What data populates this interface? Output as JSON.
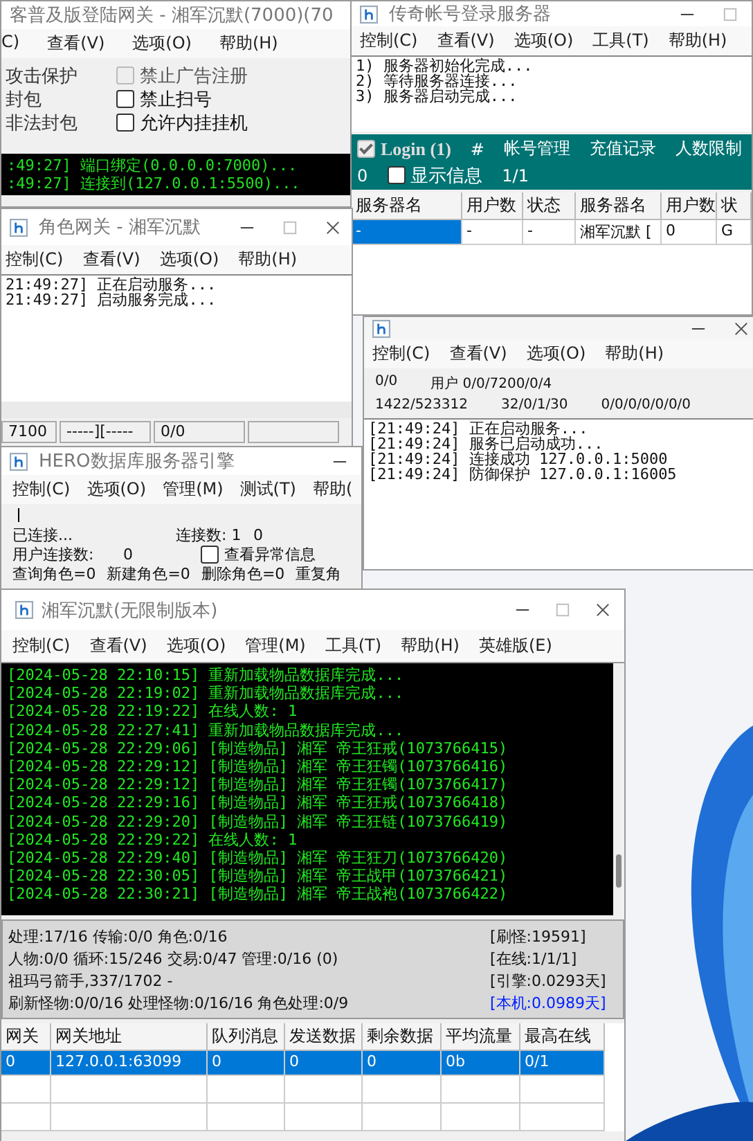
{
  "login_gateway": {
    "title": "客普及版登陆网关 - 湘军沉默(7000)(70",
    "menu": [
      "C)",
      "查看(V)",
      "选项(O)",
      "帮助(H)"
    ],
    "options_left": [
      "攻击保护",
      "封包",
      "非法封包"
    ],
    "options_right": [
      {
        "label": "禁止广告注册",
        "checked": false,
        "disabled": true
      },
      {
        "label": "禁止扫号",
        "checked": false,
        "disabled": false
      },
      {
        "label": "允许内挂挂机",
        "checked": false,
        "disabled": false
      }
    ],
    "log": [
      ":49:27] 端口绑定(0.0.0.0:7000)...",
      ":49:27] 连接到(127.0.0.1:5500)..."
    ]
  },
  "account_server": {
    "title": "传奇帐号登录服务器",
    "menu": [
      "控制(C)",
      "查看(V)",
      "选项(O)",
      "工具(T)",
      "帮助(H)"
    ],
    "log": [
      "1) 服务器初始化完成...",
      "2) 等待服务器连接...",
      "3) 服务器启动完成..."
    ],
    "login_check": {
      "label": "Login (1)",
      "checked": true,
      "disabled": true
    },
    "hash": "#",
    "links": [
      "帐号管理",
      "充值记录",
      "人数限制"
    ],
    "count": "0",
    "show_info": {
      "label": "显示信息",
      "checked": false,
      "disabled": false
    },
    "pages": "1/1",
    "table": {
      "columns": [
        "服务器名",
        "用户数",
        "状态",
        "服务器名",
        "用户数",
        "状"
      ],
      "rows": [
        {
          "cells": [
            "-",
            "-",
            "-",
            "湘军沉默 [",
            "0",
            "G"
          ],
          "selected": true
        }
      ]
    }
  },
  "role_gateway": {
    "title": "角色网关 - 湘军沉默",
    "menu": [
      "控制(C)",
      "查看(V)",
      "选项(O)",
      "帮助(H)"
    ],
    "log": [
      "21:49:27] 正在启动服务...",
      "21:49:27] 启动服务完成..."
    ],
    "status_bar": [
      "7100",
      "-----][-----",
      "0/0"
    ]
  },
  "status_window": {
    "menu": [
      "控制(C)",
      "查看(V)",
      "选项(O)",
      "帮助(H)"
    ],
    "stats": [
      [
        "0/0",
        "用户 0/0/7200/0/4"
      ],
      [
        "1422/523312",
        "32/0/1/30",
        "0/0/0/0/0/0/0"
      ]
    ],
    "log": [
      "[21:49:24] 正在启动服务...",
      "[21:49:24] 服务已启动成功...",
      "[21:49:24] 连接成功 127.0.0.1:5000",
      "[21:49:24] 防御保护 127.0.0.1:16005"
    ]
  },
  "db_engine": {
    "title": "HERO数据库服务器引擎",
    "menu": [
      "控制(C)",
      "选项(O)",
      "管理(M)",
      "测试(T)",
      "帮助("
    ],
    "connected": "已连接...",
    "conn_label": "连接数: 1",
    "conn_extra": "0",
    "user_conn_label": "用户连接数:",
    "user_conn_value": "0",
    "show_errors": {
      "label": "查看异常信息",
      "checked": false,
      "disabled": false
    },
    "counters": [
      "查询角色=0",
      "新建角色=0",
      "删除角色=0",
      "重复角"
    ]
  },
  "main_server": {
    "title": "湘军沉默(无限制版本)",
    "menu": [
      "控制(C)",
      "查看(V)",
      "选项(O)",
      "管理(M)",
      "工具(T)",
      "帮助(H)",
      "英雄版(E)"
    ],
    "log": [
      "[2024-05-28 22:10:15] 重新加载物品数据库完成...",
      "[2024-05-28 22:19:02] 重新加载物品数据库完成...",
      "[2024-05-28 22:19:22] 在线人数: 1",
      "[2024-05-28 22:27:41] 重新加载物品数据库完成...",
      "[2024-05-28 22:29:06] [制造物品] 湘军 帝王狂戒(1073766415)",
      "[2024-05-28 22:29:12] [制造物品] 湘军 帝王狂镯(1073766416)",
      "[2024-05-28 22:29:12] [制造物品] 湘军 帝王狂镯(1073766417)",
      "[2024-05-28 22:29:16] [制造物品] 湘军 帝王狂戒(1073766418)",
      "[2024-05-28 22:29:20] [制造物品] 湘军 帝王狂链(1073766419)",
      "[2024-05-28 22:29:22] 在线人数: 1",
      "[2024-05-28 22:29:40] [制造物品] 湘军 帝王狂刀(1073766420)",
      "[2024-05-28 22:30:05] [制造物品] 湘军 帝王战甲(1073766421)",
      "[2024-05-28 22:30:21] [制造物品] 湘军 帝王战袍(1073766422)"
    ],
    "stats": [
      {
        "left": "处理:17/16 传输:0/0 角色:0/16",
        "right": "[刷怪:19591]",
        "highlight": false
      },
      {
        "left": "人物:0/0 循环:15/246 交易:0/47 管理:0/16 (0)",
        "right": "[在线:1/1/1]",
        "highlight": false
      },
      {
        "left": "祖玛弓箭手,337/1702 -",
        "right": "[引擎:0.0293天]",
        "highlight": false
      },
      {
        "left": "刷新怪物:0/0/16 处理怪物:0/16/16 角色处理:0/9",
        "right": "[本机:0.0989天]",
        "highlight": true
      }
    ],
    "table": {
      "columns": [
        "网关",
        "网关地址",
        "队列消息",
        "发送数据",
        "剩余数据",
        "平均流量",
        "最高在线"
      ],
      "rows": [
        {
          "cells": [
            "0",
            "127.0.0.1:63099",
            "0",
            "0",
            "0",
            "0b",
            "0/1"
          ],
          "selected": true
        }
      ]
    }
  }
}
